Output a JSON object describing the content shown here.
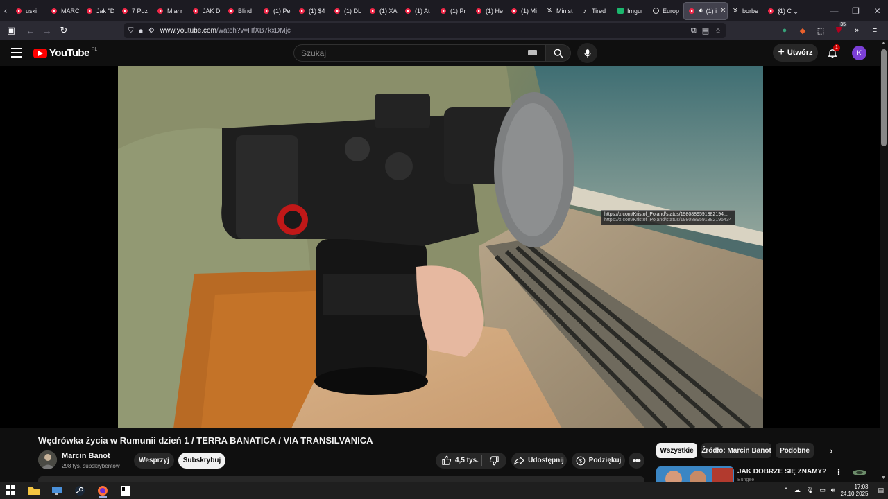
{
  "browser": {
    "tabs": [
      {
        "title": "uski",
        "icon": "youtube-icon"
      },
      {
        "title": "MARC",
        "icon": "youtube-icon"
      },
      {
        "title": "Jak \"D",
        "icon": "youtube-icon"
      },
      {
        "title": "7 Poz",
        "icon": "youtube-icon"
      },
      {
        "title": "Miał r",
        "icon": "youtube-icon"
      },
      {
        "title": "JAK D",
        "icon": "youtube-icon"
      },
      {
        "title": "Blind",
        "icon": "youtube-icon"
      },
      {
        "title": "(1) Pe",
        "icon": "youtube-icon"
      },
      {
        "title": "(1) $4",
        "icon": "youtube-icon"
      },
      {
        "title": "(1) DL",
        "icon": "youtube-icon"
      },
      {
        "title": "(1) XA",
        "icon": "youtube-icon"
      },
      {
        "title": "(1) At",
        "icon": "youtube-icon"
      },
      {
        "title": "(1) Pr",
        "icon": "youtube-icon"
      },
      {
        "title": "(1) He",
        "icon": "youtube-icon"
      },
      {
        "title": "(1) Mi",
        "icon": "youtube-icon"
      },
      {
        "title": "Minist",
        "icon": "x-icon"
      },
      {
        "title": "Tired",
        "icon": "tiktok-icon"
      },
      {
        "title": "Imgur",
        "icon": "imgur-icon"
      },
      {
        "title": "Europ",
        "icon": "globe-icon"
      },
      {
        "title": "(1) i",
        "icon": "youtube-icon",
        "active": true
      },
      {
        "title": "borbe",
        "icon": "x-icon"
      },
      {
        "title": "(1) C",
        "icon": "youtube-icon"
      }
    ],
    "url_host": "www.youtube.com",
    "url_path": "/watch?v=HfXB7kxDMjc",
    "ext_badge": "35"
  },
  "yt": {
    "logo_text": "YouTube",
    "country_code": "PL",
    "search_placeholder": "Szukaj",
    "create_label": "Utwórz",
    "notif_count": "1",
    "avatar_letter": "K"
  },
  "video": {
    "hover_url": "https://x.com/Kristof_Poland/status/1980889591382194...",
    "hover_url_sub": "https://x.com/Kristof_Poland/status/1980889591382195434",
    "title": "Wędrówka życia w Rumunii dzień 1 / TERRA BANATICA / VIA TRANSILVANICA",
    "channel": "Marcin Banot",
    "subscribers": "298 tys. subskrybentów",
    "support_label": "Wesprzyj",
    "subscribe_label": "Subskrybuj",
    "likes": "4,5 tys.",
    "share_label": "Udostępnij",
    "thanks_label": "Podziękuj"
  },
  "sidebar": {
    "chips": [
      "Wszystkie",
      "Źródło: Marcin Banot",
      "Podobne"
    ],
    "rec_title": "JAK DOBRZE SIĘ ZNAMY?",
    "rec_channel": "Bungee"
  },
  "taskbar": {
    "time": "17:03",
    "date": "24.10.2025"
  },
  "colors": {
    "yt_red": "#ff0000",
    "bg": "#0f0f0f",
    "avatar": "#7b3fd6"
  }
}
